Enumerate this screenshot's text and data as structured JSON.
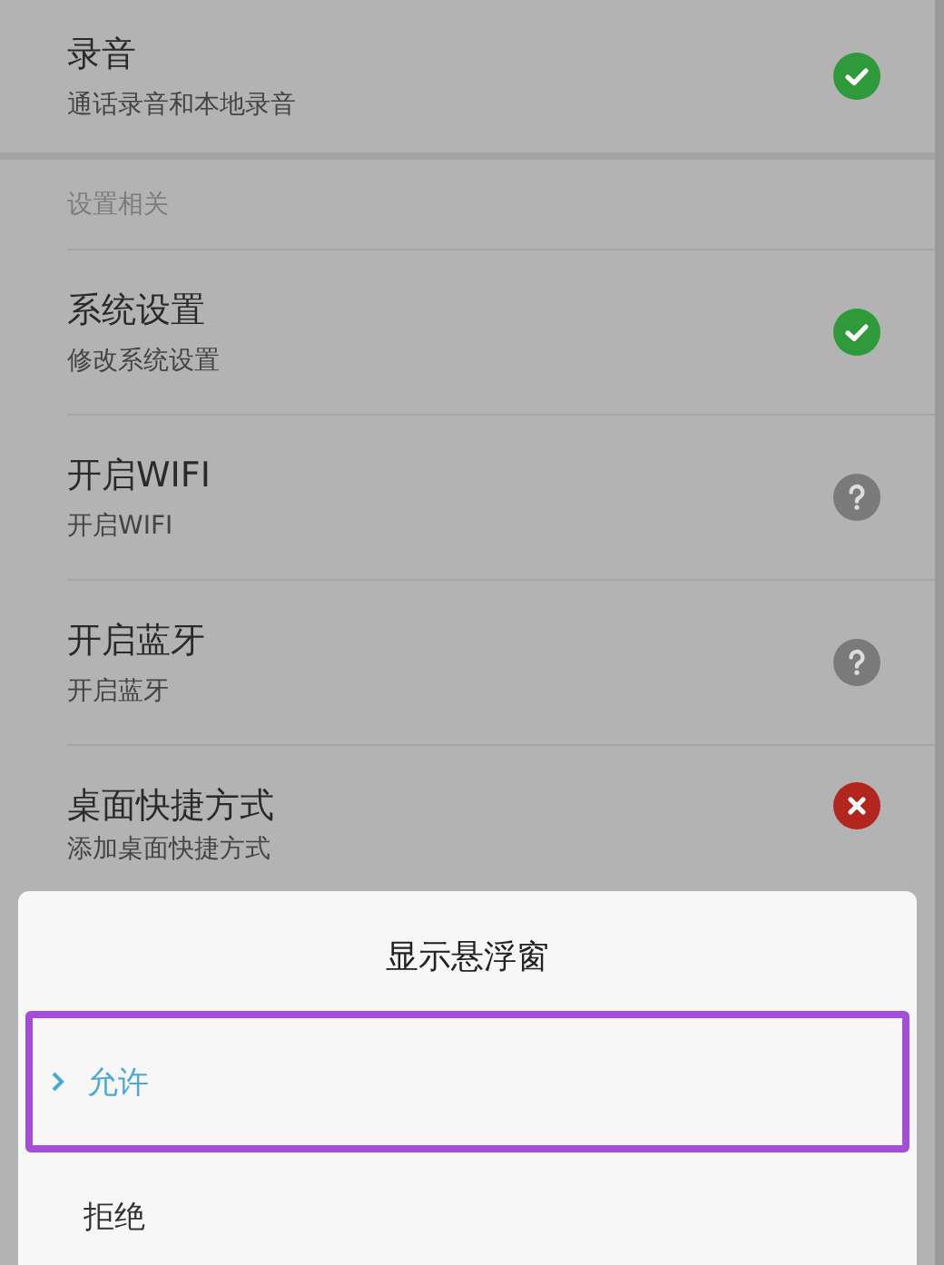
{
  "permissions_top": [
    {
      "title": "录音",
      "subtitle": "通话录音和本地录音",
      "kind": "granted"
    }
  ],
  "section_header": "设置相关",
  "permissions": [
    {
      "title": "系统设置",
      "subtitle": "修改系统设置",
      "kind": "granted"
    },
    {
      "title": "开启WIFI",
      "subtitle": "开启WIFI",
      "kind": "unknown"
    },
    {
      "title": "开启蓝牙",
      "subtitle": "开启蓝牙",
      "kind": "unknown"
    },
    {
      "title": "桌面快捷方式",
      "subtitle": "添加桌面快捷方式",
      "kind": "denied"
    }
  ],
  "dialog": {
    "title": "显示悬浮窗",
    "options": [
      {
        "label": "允许",
        "selected": true
      },
      {
        "label": "拒绝",
        "selected": false
      }
    ]
  }
}
